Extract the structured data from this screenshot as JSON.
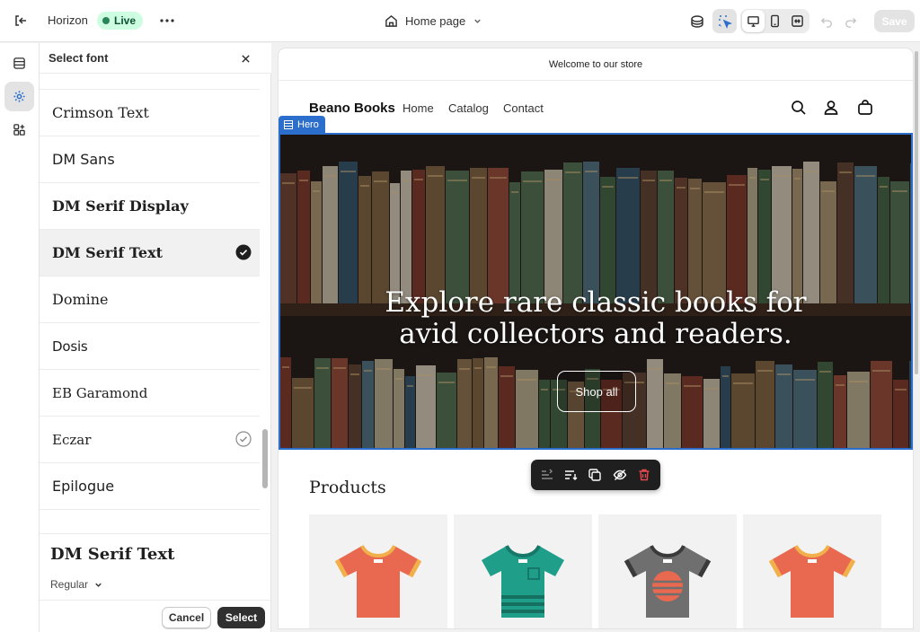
{
  "topbar": {
    "store_name": "Horizon",
    "status": "Live",
    "page_selector": "Home page",
    "save_label": "Save"
  },
  "font_panel": {
    "title": "Select font",
    "fonts": [
      {
        "name": "Crimson Text",
        "selected": false
      },
      {
        "name": "DM Sans",
        "selected": false
      },
      {
        "name": "DM Serif Display",
        "selected": false
      },
      {
        "name": "DM Serif Text",
        "selected": true
      },
      {
        "name": "Domine",
        "selected": false
      },
      {
        "name": "Dosis",
        "selected": false
      },
      {
        "name": "EB Garamond",
        "selected": false
      },
      {
        "name": "Eczar",
        "selected": false
      },
      {
        "name": "Epilogue",
        "selected": false
      }
    ],
    "preview_font": "DM Serif Text",
    "preview_style": "Regular",
    "cancel_label": "Cancel",
    "select_label": "Select"
  },
  "store": {
    "announcement": "Welcome to our store",
    "brand": "Beano Books",
    "nav": [
      "Home",
      "Catalog",
      "Contact"
    ],
    "hero_tag": "Hero",
    "hero_heading_line1": "Explore rare classic books for",
    "hero_heading_line2": "avid collectors and readers.",
    "hero_button": "Shop all",
    "products_title": "Products"
  },
  "colors": {
    "accent": "#2c6ecb",
    "live_bg": "#cdfee1",
    "live_dot": "#29845a",
    "primary_button": "#303030"
  },
  "icons": [
    "exit-icon",
    "more-icon",
    "home-icon",
    "chevron-down-icon",
    "inspector-icon",
    "select-tool-icon",
    "desktop-icon",
    "mobile-icon",
    "fullwidth-icon",
    "undo-icon",
    "redo-icon",
    "sections-icon",
    "settings-icon",
    "apps-icon",
    "close-icon",
    "check-icon",
    "search-icon",
    "account-icon",
    "cart-icon",
    "move-icon",
    "reorder-icon",
    "duplicate-icon",
    "hide-icon",
    "delete-icon"
  ]
}
